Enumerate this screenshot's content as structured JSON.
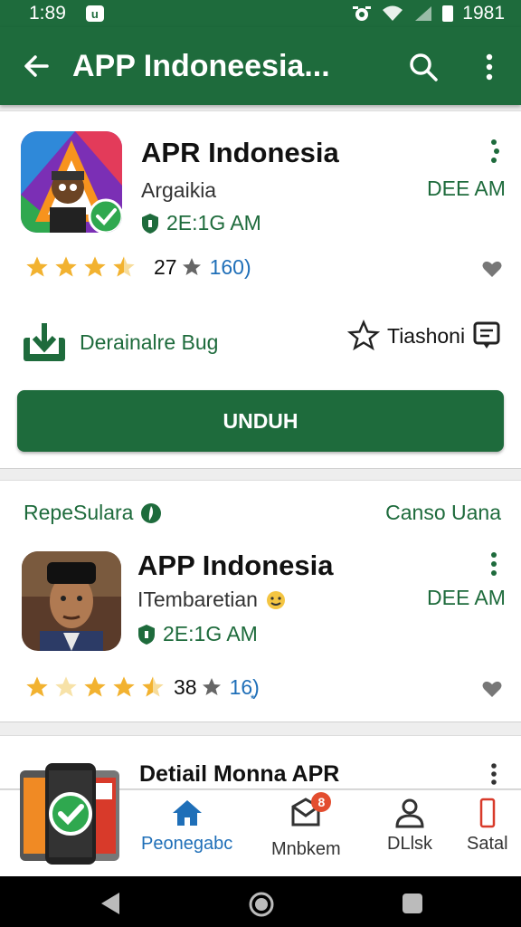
{
  "status_bar": {
    "time": "1:89",
    "right_text": "1981"
  },
  "app_bar": {
    "title": "APP Indoneesia..."
  },
  "card1": {
    "name": "APR Indonesia",
    "developer": "Argaikia",
    "size": "2E:1G AM",
    "date": "DEE AM",
    "rating_value": "27",
    "rating_count": "160)",
    "download_label": "Derainalre Bug",
    "wishlist_label": "Tiashoni",
    "install_button": "UNDUH"
  },
  "card2": {
    "section_left": "RepeSulara",
    "section_right": "Canso Uana",
    "name": "APP Indonesia",
    "developer": "ITembaretian",
    "size": "2E:1G AM",
    "date": "DEE AM",
    "rating_value": "38",
    "rating_count": "16͙)"
  },
  "card3": {
    "name": "Detiail Monna APR"
  },
  "bottom_nav": {
    "items": [
      {
        "label": "Peonegabc",
        "icon": "home-icon",
        "active": true
      },
      {
        "label": "Mnbkem",
        "icon": "mail-icon",
        "badge": "8"
      },
      {
        "label": "DLlsk",
        "icon": "person-icon"
      },
      {
        "label": "Satal",
        "icon": "phone-icon"
      }
    ]
  },
  "colors": {
    "primary": "#1e6b3c",
    "link": "#1f6fb8",
    "star": "#f2b230",
    "badge": "#e34d2f"
  }
}
